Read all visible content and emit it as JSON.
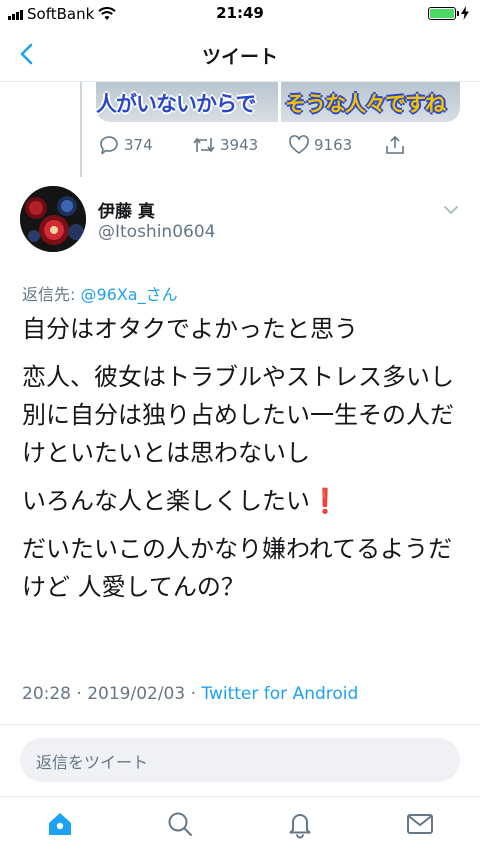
{
  "status_bar": {
    "carrier": "SoftBank",
    "time": "21:49"
  },
  "nav": {
    "title": "ツイート"
  },
  "quoted_media": {
    "caption_left": "人がいないからで",
    "caption_right": "そうな人々ですね"
  },
  "previous_tweet_actions": {
    "replies": "374",
    "retweets": "3943",
    "likes": "9163"
  },
  "tweet": {
    "display_name": "伊藤 真",
    "handle": "@Itoshin0604",
    "reply_prefix": "返信先: ",
    "reply_mention": "@96Xa_さん",
    "paragraphs": [
      "自分はオタクでよかったと思う",
      "恋人、彼女はトラブルやストレス多いし 別に自分は独り占めしたい一生その人だけといたいとは思わないし",
      "いろんな人と楽しくしたい",
      "だいたいこの人かなり嫌われてるようだけど 人愛してんの？"
    ],
    "emoji": "❗",
    "timestamp": "20:28 · 2019/02/03 · ",
    "source": "Twitter for Android"
  },
  "reply_box": {
    "placeholder": "返信をツイート"
  },
  "colors": {
    "accent": "#1da1f2",
    "muted": "#657786",
    "text": "#14171a",
    "battery": "#4cd964"
  },
  "icons": {
    "back": "chevron-left-icon",
    "reply": "reply-icon",
    "retweet": "retweet-icon",
    "like": "heart-icon",
    "share": "share-icon",
    "more": "chevron-down-icon",
    "tabs": [
      "home-icon",
      "search-icon",
      "bell-icon",
      "mail-icon"
    ]
  }
}
